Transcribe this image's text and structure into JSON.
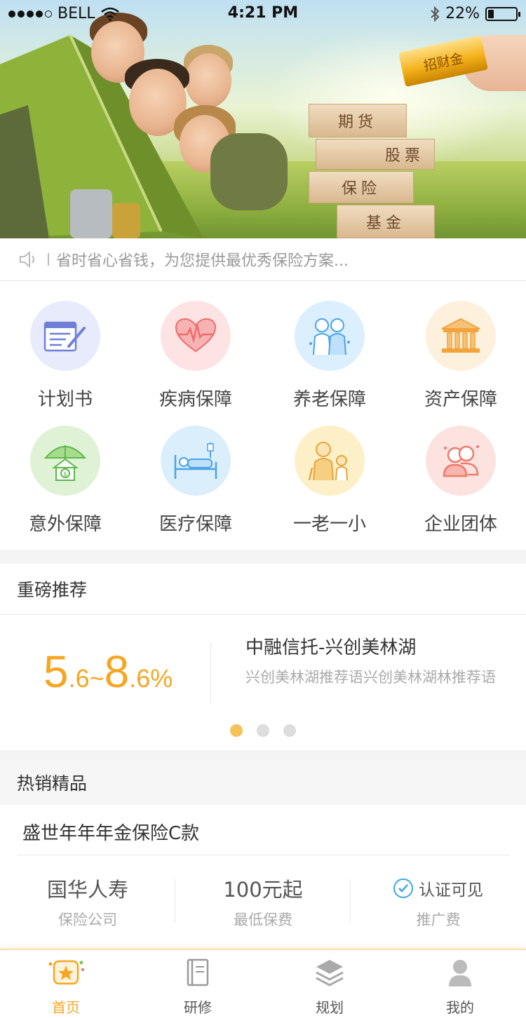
{
  "status_bar": {
    "carrier": "BELL",
    "time": "4:21 PM",
    "battery": "22%",
    "battery_level": 0.22
  },
  "banner": {
    "gold_bar_text": "招财金",
    "blocks": [
      "期货",
      "股票",
      "保险",
      "基金"
    ]
  },
  "notice": {
    "text": "省时省心省钱，为您提供最优秀保险方案..."
  },
  "categories": [
    {
      "label": "计划书",
      "icon": "plan-icon",
      "bg": "#e8ebfb",
      "color": "#6f7fd8"
    },
    {
      "label": "疾病保障",
      "icon": "heart-icon",
      "bg": "#fde3e3",
      "color": "#ef6b6b"
    },
    {
      "label": "养老保障",
      "icon": "elderly-couple-icon",
      "bg": "#dcefff",
      "color": "#4aa3e8"
    },
    {
      "label": "资产保障",
      "icon": "bank-icon",
      "bg": "#fdf0dd",
      "color": "#f2a33a"
    },
    {
      "label": "意外保障",
      "icon": "umbrella-house-icon",
      "bg": "#dff2d6",
      "color": "#5cb84a"
    },
    {
      "label": "医疗保障",
      "icon": "hospital-bed-icon",
      "bg": "#dbeefc",
      "color": "#4aa3e8"
    },
    {
      "label": "一老一小",
      "icon": "grandparent-child-icon",
      "bg": "#fdf0c9",
      "color": "#e6a53a"
    },
    {
      "label": "企业团体",
      "icon": "group-icon",
      "bg": "#fde3e0",
      "color": "#ef7a6b"
    }
  ],
  "featured": {
    "section_title": "重磅推荐",
    "rate": {
      "low_int": "5",
      "low_dec": ".6",
      "sep": "~",
      "high_int": "8",
      "high_dec": ".6%"
    },
    "title": "中融信托-兴创美林湖",
    "description": "兴创美林湖推荐语兴创美林湖林推荐语",
    "page_count": 3,
    "active_page": 0
  },
  "hot": {
    "section_title": "热销精品",
    "product_name": "盛世年年年金保险C款",
    "stats": [
      {
        "value": "国华人寿",
        "label": "保险公司"
      },
      {
        "value": "100元起",
        "label": "最低保费"
      },
      {
        "value": "认证可见",
        "label": "推广费"
      }
    ]
  },
  "tabbar": {
    "tabs": [
      {
        "label": "首页",
        "icon": "home-star-icon",
        "active": true
      },
      {
        "label": "研修",
        "icon": "book-icon",
        "active": false
      },
      {
        "label": "规划",
        "icon": "layers-icon",
        "active": false
      },
      {
        "label": "我的",
        "icon": "user-icon",
        "active": false
      }
    ]
  },
  "colors": {
    "accent": "#f5a623",
    "link_blue": "#3ca7e8"
  }
}
